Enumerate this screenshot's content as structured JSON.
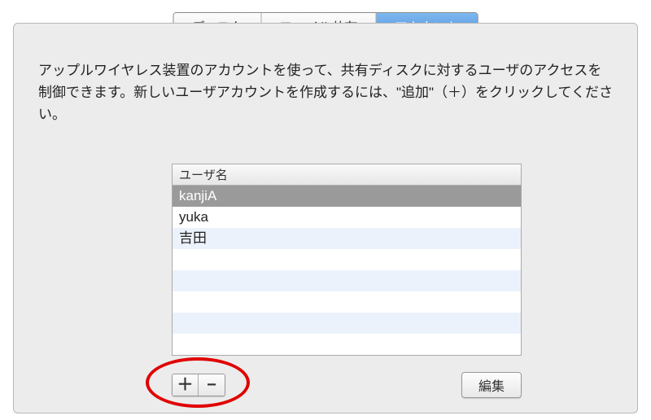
{
  "tabs": [
    {
      "label": "ディスク",
      "active": false
    },
    {
      "label": "ファイル共有",
      "active": false
    },
    {
      "label": "アカウント",
      "active": true
    }
  ],
  "description": "アップルワイヤレス装置のアカウントを使って、共有ディスクに対するユーザのアクセスを制御できます。新しいユーザアカウントを作成するには、\"追加\"（＋）をクリックしてください。",
  "table": {
    "header": "ユーザ名",
    "rows": [
      {
        "name": "kanjiA",
        "selected": true
      },
      {
        "name": "yuka",
        "selected": false
      },
      {
        "name": "吉田",
        "selected": false
      }
    ]
  },
  "buttons": {
    "add": "＋",
    "remove": "−",
    "edit": "編集"
  }
}
